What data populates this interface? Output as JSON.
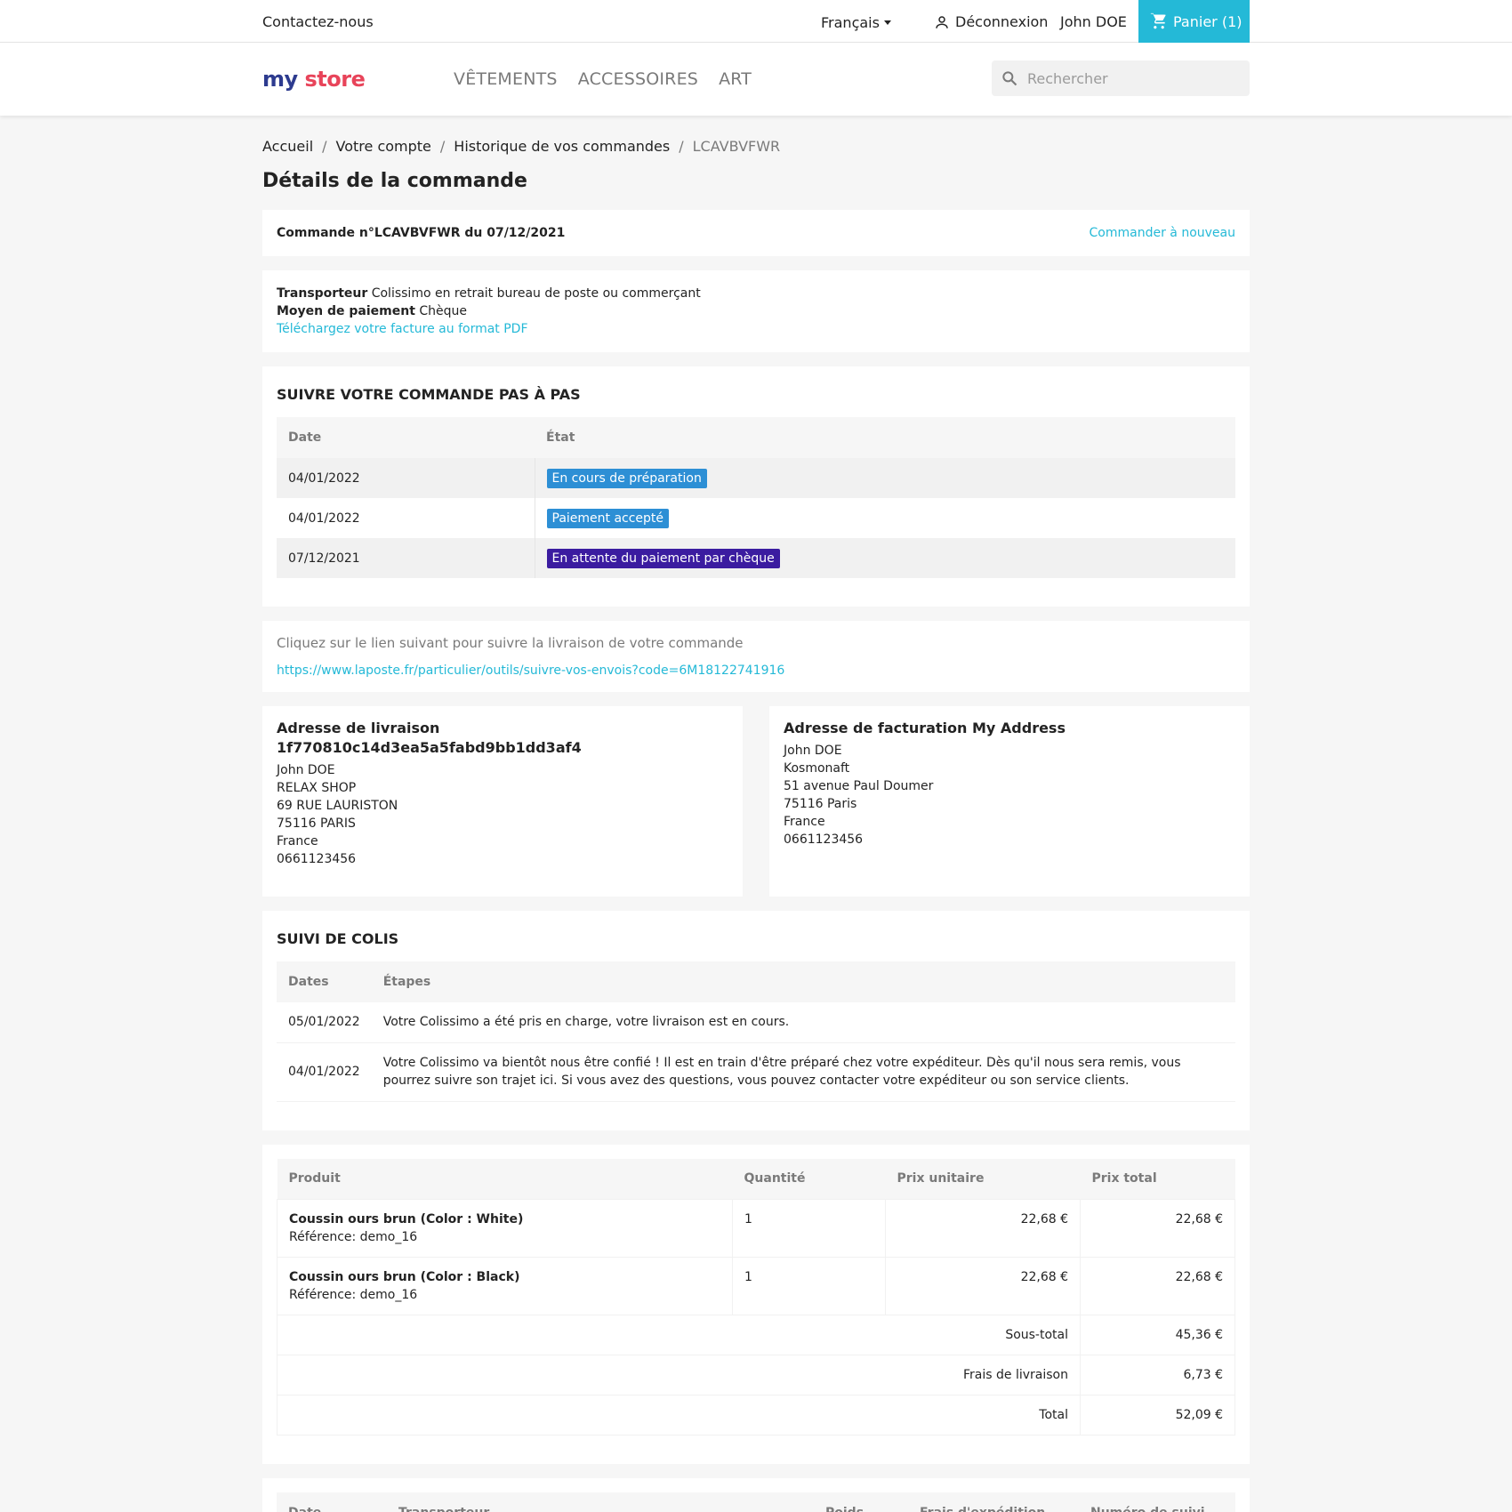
{
  "topnav": {
    "contact": "Contactez-nous",
    "language": "Français",
    "logout": "Déconnexion",
    "user": "John DOE",
    "cart": "Panier (1)"
  },
  "header": {
    "logo": {
      "part1": "my",
      "part2": "store"
    },
    "menu": [
      "VÊTEMENTS",
      "ACCESSOIRES",
      "ART"
    ],
    "search_placeholder": "Rechercher"
  },
  "breadcrumb": [
    "Accueil",
    "Votre compte",
    "Historique de vos commandes",
    "LCAVBVFWR"
  ],
  "page_title": "Détails de la commande",
  "order": {
    "reference_line": "Commande n°LCAVBVFWR du 07/12/2021",
    "reorder": "Commander à nouveau",
    "carrier_label": "Transporteur",
    "carrier_value": "Colissimo en retrait bureau de poste ou commerçant",
    "payment_label": "Moyen de paiement",
    "payment_value": "Chèque",
    "invoice_link": "Téléchargez votre facture au format PDF"
  },
  "history": {
    "title": "SUIVRE VOTRE COMMANDE PAS À PAS",
    "headers": [
      "Date",
      "État"
    ],
    "rows": [
      {
        "date": "04/01/2022",
        "state": "En cours de préparation",
        "color": "#2d8fd5"
      },
      {
        "date": "04/01/2022",
        "state": "Paiement accepté",
        "color": "#2d8fd5"
      },
      {
        "date": "07/12/2021",
        "state": "En attente du paiement par chèque",
        "color": "#3b1ca0"
      }
    ]
  },
  "tracking": {
    "hint": "Cliquez sur le lien suivant pour suivre la livraison de votre commande",
    "url": "https://www.laposte.fr/particulier/outils/suivre-vos-envois?code=6M18122741916"
  },
  "delivery_address": {
    "title": "Adresse de livraison 1f770810c14d3ea5a5fabd9bb1dd3af4",
    "lines": [
      "John DOE",
      "RELAX SHOP",
      "69 RUE LAURISTON",
      "75116 PARIS",
      "France",
      "0661123456"
    ]
  },
  "invoice_address": {
    "title": "Adresse de facturation My Address",
    "lines": [
      "John DOE",
      "Kosmonaft",
      "51 avenue Paul Doumer",
      "75116 Paris",
      "France",
      "0661123456"
    ]
  },
  "parcel": {
    "title": "SUIVI DE COLIS",
    "headers": [
      "Dates",
      "Étapes"
    ],
    "rows": [
      {
        "date": "05/01/2022",
        "step": "Votre Colissimo a été pris en charge, votre livraison est en cours."
      },
      {
        "date": "04/01/2022",
        "step": "Votre Colissimo va bientôt nous être confié ! Il est en train d'être préparé chez votre expéditeur. Dès qu'il nous sera remis, vous pourrez suivre son trajet ici. Si vous avez des questions, vous pouvez contacter votre expéditeur ou son service clients."
      }
    ]
  },
  "products": {
    "headers": [
      "Produit",
      "Quantité",
      "Prix unitaire",
      "Prix total"
    ],
    "rows": [
      {
        "name": "Coussin ours brun (Color : White)",
        "ref": "Référence: demo_16",
        "qty": "1",
        "unit": "22,68 €",
        "total": "22,68 €"
      },
      {
        "name": "Coussin ours brun (Color : Black)",
        "ref": "Référence: demo_16",
        "qty": "1",
        "unit": "22,68 €",
        "total": "22,68 €"
      }
    ],
    "subtotal_label": "Sous-total",
    "subtotal": "45,36 €",
    "shipping_label": "Frais de livraison",
    "shipping": "6,73 €",
    "total_label": "Total",
    "total": "52,09 €"
  },
  "shipping_table": {
    "headers": [
      "Date",
      "Transporteur",
      "Poids",
      "Frais d'expédition",
      "Numéro de suivi"
    ]
  },
  "colors": {
    "accent": "#24b9d7",
    "status_blue": "#2d8fd5",
    "status_purple": "#3b1ca0"
  }
}
